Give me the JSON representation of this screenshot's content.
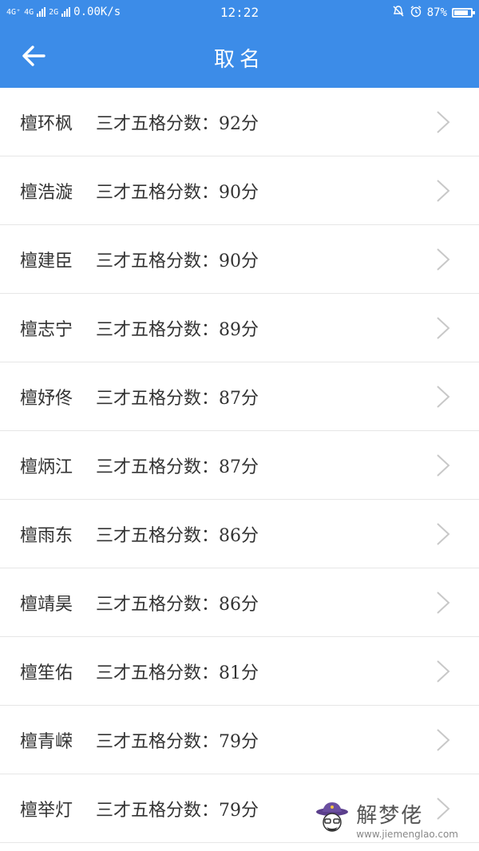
{
  "status_bar": {
    "network_1": "4G⁺",
    "network_2": "4G",
    "network_3": "2G",
    "speed": "0.00K/s",
    "time": "12:22",
    "battery": "87%",
    "battery_level": 0.87,
    "icons": [
      "mute-icon",
      "alarm-icon"
    ]
  },
  "header": {
    "title": "取名",
    "back_icon": "arrow-left-icon"
  },
  "names": [
    {
      "name": "檀环枫",
      "score_label": "三才五格分数：92分"
    },
    {
      "name": "檀浩漩",
      "score_label": "三才五格分数：90分"
    },
    {
      "name": "檀建臣",
      "score_label": "三才五格分数：90分"
    },
    {
      "name": "檀志宁",
      "score_label": "三才五格分数：89分"
    },
    {
      "name": "檀妤佟",
      "score_label": "三才五格分数：87分"
    },
    {
      "name": "檀炳江",
      "score_label": "三才五格分数：87分"
    },
    {
      "name": "檀雨东",
      "score_label": "三才五格分数：86分"
    },
    {
      "name": "檀靖昊",
      "score_label": "三才五格分数：86分"
    },
    {
      "name": "檀笙佑",
      "score_label": "三才五格分数：81分"
    },
    {
      "name": "檀青嵘",
      "score_label": "三才五格分数：79分"
    },
    {
      "name": "檀举灯",
      "score_label": "三才五格分数：79分"
    }
  ],
  "watermark": {
    "title": "解梦佬",
    "url": "www.jiemenglao.com"
  },
  "colors": {
    "accent": "#3c8ce8",
    "text": "#333333",
    "divider": "#e6e6e6",
    "chevron": "#c8c8c8"
  }
}
